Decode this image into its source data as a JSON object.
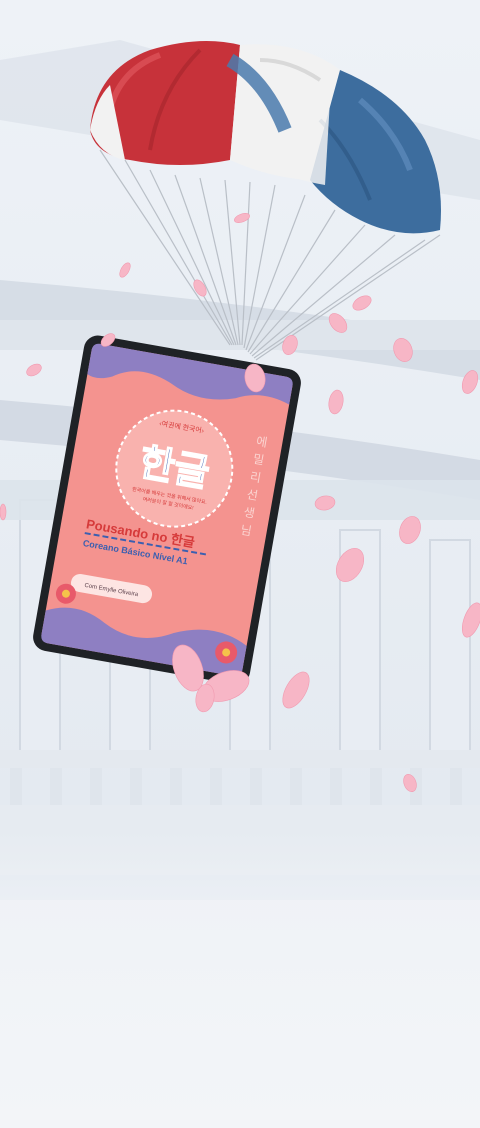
{
  "cover": {
    "badge_top": "‹여권에 한국어›",
    "hangul_title": "한글",
    "tagline_line1": "한국어를 배우는 것을 위해서 많아요.",
    "tagline_line2": "여러분이 잘 할 것이에요!",
    "title_main": "Pousando no 한글",
    "subtitle": "Coreano Básico Nível A1",
    "author_label": "Com Emylle Oliveira",
    "vertical_text": "에밀리선생님"
  },
  "colors": {
    "cover_bg": "#f4938f",
    "cover_accent": "#8e7fc2",
    "hangul_blue": "#3b5fb0",
    "title_red": "#d63a3a",
    "parachute_red": "#c7323a",
    "parachute_white": "#f2f2f2",
    "parachute_blue": "#3d6d9e",
    "petal_pink": "#f7b6c6"
  },
  "icons": {
    "parachute": "parachute-icon",
    "petal": "cherry-blossom-petal-icon",
    "flower": "hibiscus-flower-icon"
  }
}
